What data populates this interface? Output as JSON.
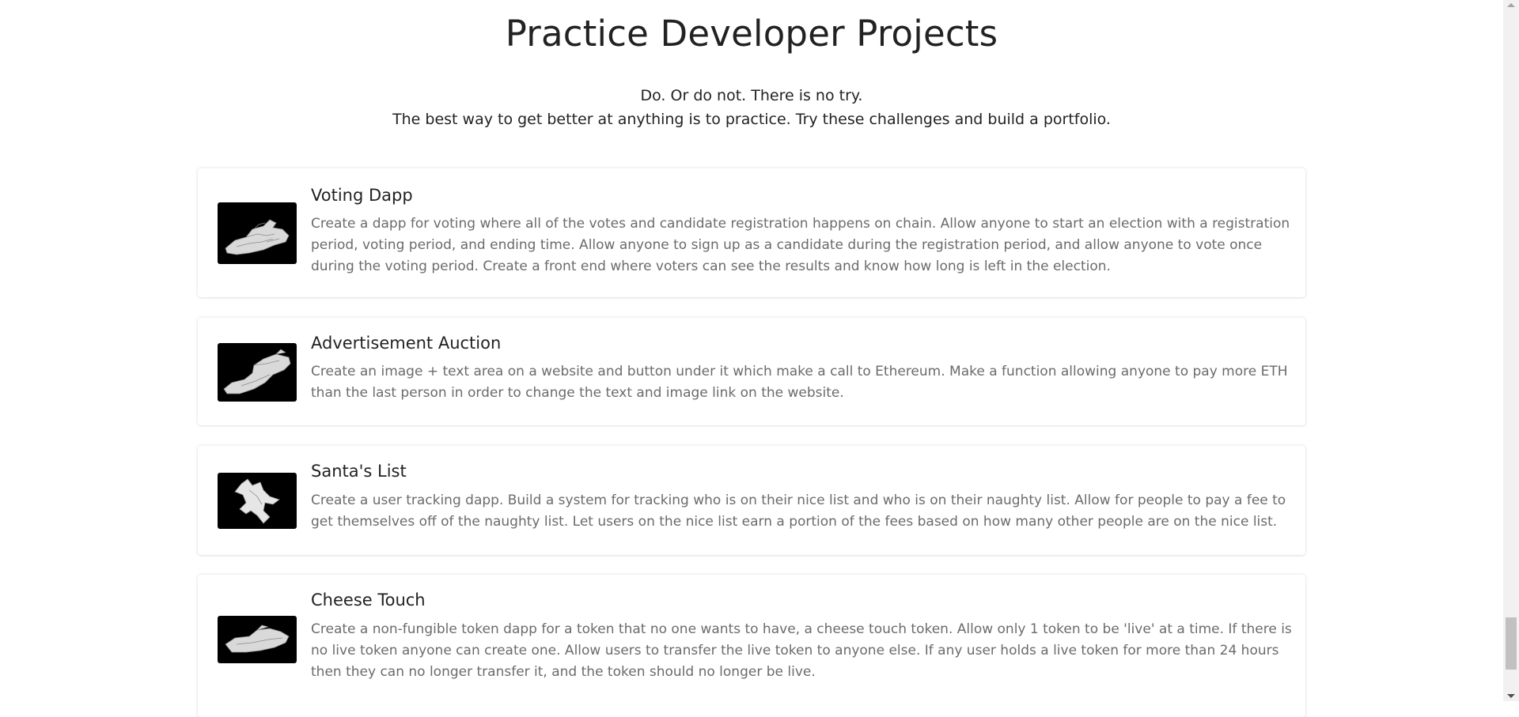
{
  "header": {
    "title": "Practice Developer Projects",
    "subtitle_line1": "Do. Or do not. There is no try.",
    "subtitle_line2": "The best way to get better at anything is to practice. Try these challenges and build a portfolio."
  },
  "projects": [
    {
      "title": "Voting Dapp",
      "description": "Create a dapp for voting where all of the votes and candidate registration happens on chain. Allow anyone to start an election with a registration period, voting period, and ending time. Allow anyone to sign up as a candidate during the registration period, and allow anyone to vote once during the voting period. Create a front end where voters can see the results and know how long is left in the election.",
      "image_icon": "spaceship-icon"
    },
    {
      "title": "Advertisement Auction",
      "description": "Create an image + text area on a website and button under it which make a call to Ethereum. Make a function allowing anyone to pay more ETH than the last person in order to change the text and image link on the website.",
      "image_icon": "spaceship-icon"
    },
    {
      "title": "Santa's List",
      "description": "Create a user tracking dapp. Build a system for tracking who is on their nice list and who is on their naughty list. Allow for people to pay a fee to get themselves off of the naughty list. Let users on the nice list earn a portion of the fees based on how many other people are on the nice list.",
      "image_icon": "spaceship-icon"
    },
    {
      "title": "Cheese Touch",
      "description": "Create a non-fungible token dapp for a token that no one wants to have, a cheese touch token. Allow only 1 token to be 'live' at a time. If there is no live token anyone can create one. Allow users to transfer the live token to anyone else. If any user holds a live token for more than 24 hours then they can no longer transfer it, and the token should no longer be live.",
      "image_icon": "spaceship-icon"
    }
  ],
  "colors": {
    "background": "#ffffff",
    "title_text": "#222222",
    "description_text": "#6b6b6b",
    "thumbnail_bg": "#000000"
  }
}
